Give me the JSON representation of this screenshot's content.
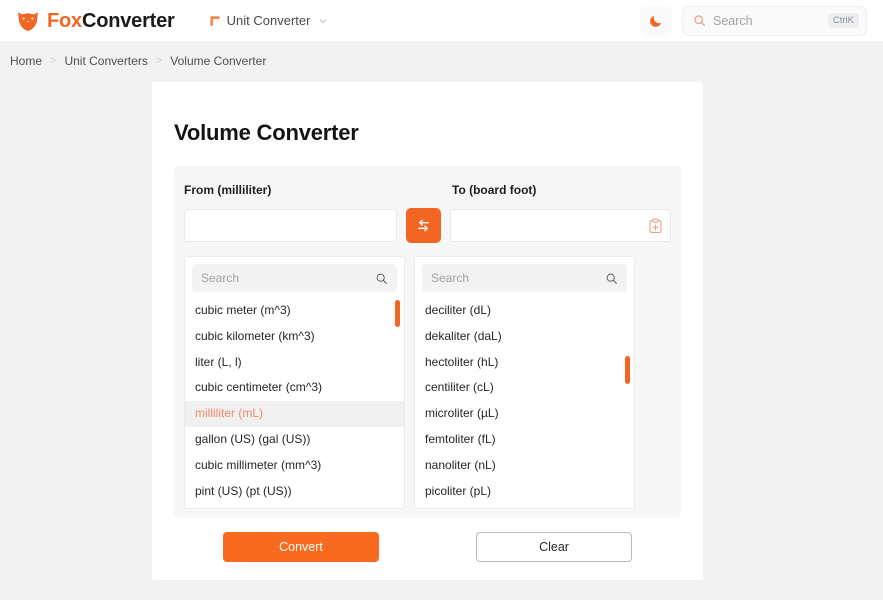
{
  "header": {
    "brand_fox": "Fox",
    "brand_converter": "Converter",
    "nav_label": "Unit Converter",
    "search_placeholder": "Search",
    "search_shortcut": "CtrlK",
    "accent_color": "#f26522"
  },
  "breadcrumb": {
    "items": [
      {
        "label": "Home"
      },
      {
        "label": "Unit Converters"
      },
      {
        "label": "Volume Converter"
      }
    ],
    "separator": ">",
    "current_color": "#f08a6a"
  },
  "main": {
    "title": "Volume Converter",
    "from": {
      "label": "From (milliliter)",
      "value": "",
      "placeholder": "",
      "search_placeholder": "Search",
      "selected_unit": "milliliter (mL)",
      "units": [
        "cubic meter (m^3)",
        "cubic kilometer (km^3)",
        "liter (L, l)",
        "cubic centimeter (cm^3)",
        "milliliter (mL)",
        "gallon (US) (gal (US))",
        "cubic millimeter (mm^3)",
        "pint (US) (pt (US))"
      ]
    },
    "to": {
      "label": "To (board foot)",
      "value": "",
      "placeholder": "",
      "search_placeholder": "Search",
      "selected_unit": "",
      "units": [
        "deciliter (dL)",
        "dekaliter (daL)",
        "hectoliter (hL)",
        "centiliter (cL)",
        "microliter (µL)",
        "femtoliter (fL)",
        "nanoliter (nL)",
        "picoliter (pL)"
      ]
    },
    "swap_icon": "swap-arrows-icon",
    "paste_icon": "clipboard-plus-icon",
    "convert_label": "Convert",
    "clear_label": "Clear"
  }
}
